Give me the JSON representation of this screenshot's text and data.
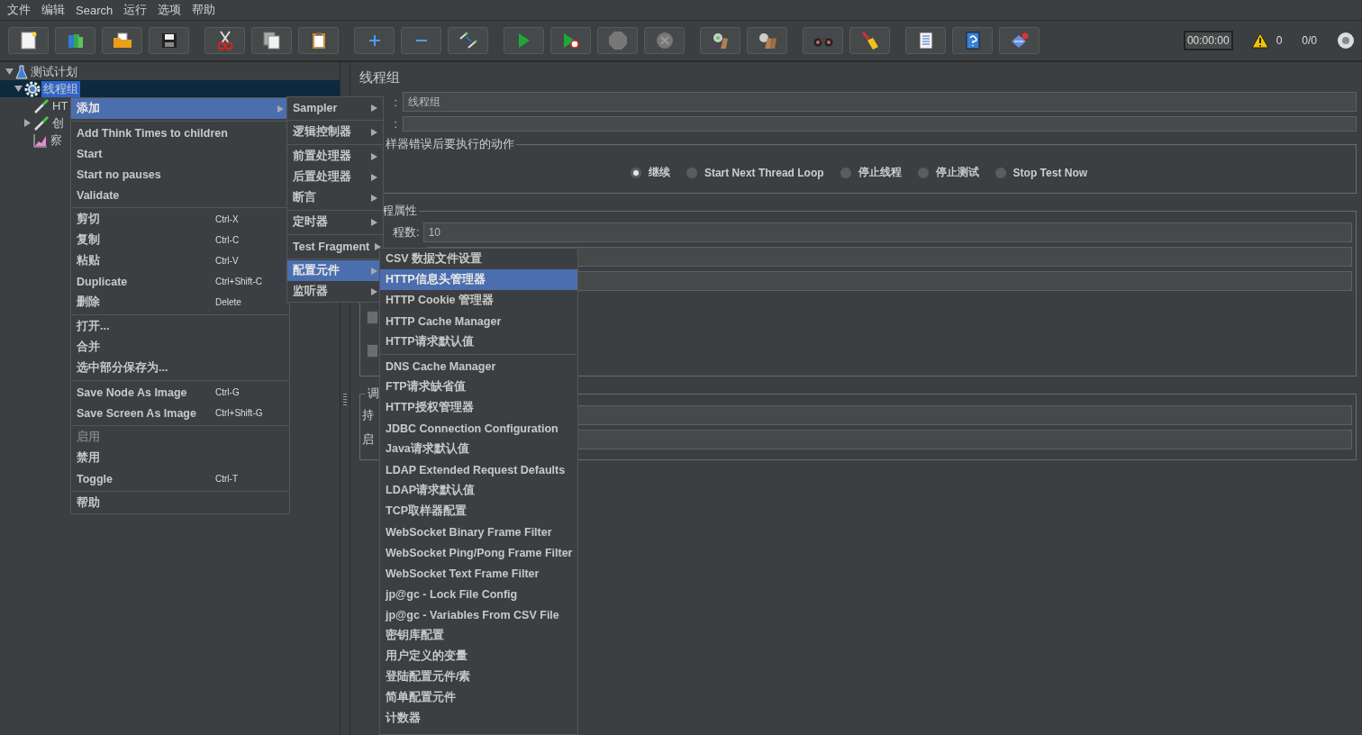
{
  "menubar": [
    {
      "label": "文件"
    },
    {
      "label": "编辑"
    },
    {
      "label": "Search"
    },
    {
      "label": "运行"
    },
    {
      "label": "选项"
    },
    {
      "label": "帮助"
    }
  ],
  "toolbar": {
    "timer": "00:00:00",
    "warnings": "0",
    "threads": "0/0"
  },
  "tree": [
    {
      "label": "测试计划",
      "kind": "test_plan",
      "expanded": true,
      "selected": false,
      "children": [
        {
          "label": "线程组",
          "kind": "thread_group",
          "expanded": true,
          "selected": true,
          "children": [
            {
              "label": "HT",
              "kind": "sampler",
              "selected": false
            },
            {
              "label": "创",
              "kind": "sampler",
              "expanded": false,
              "selected": false
            },
            {
              "label": "察",
              "kind": "listener",
              "selected": false
            }
          ]
        }
      ]
    }
  ],
  "panel": {
    "title": "线程组",
    "name_field": {
      "label": ":",
      "value": "线程组"
    },
    "comment_field": {
      "label": ":"
    },
    "on_error": {
      "title": "样器错误后要执行的动作",
      "options": [
        {
          "label": "继续",
          "selected": true
        },
        {
          "label": "Start Next Thread Loop",
          "selected": false
        },
        {
          "label": "停止线程",
          "selected": false
        },
        {
          "label": "停止测试",
          "selected": false
        },
        {
          "label": "Stop Test Now",
          "selected": false
        }
      ]
    },
    "thread_properties": {
      "title": "程属性",
      "threads_field": {
        "label": "程数:",
        "value": "10"
      },
      "checkboxes": [
        {
          "checked": false
        },
        {
          "checked": false
        }
      ]
    },
    "scheduler": {
      "title": "调",
      "fields": [
        {
          "label": "持"
        },
        {
          "label": "启"
        }
      ]
    }
  },
  "context_menu": {
    "sections": [
      [
        {
          "label": "添加",
          "submenu": true,
          "selected": true
        }
      ],
      [
        {
          "label": "Add Think Times to children"
        },
        {
          "label": "Start"
        },
        {
          "label": "Start no pauses"
        },
        {
          "label": "Validate"
        }
      ],
      [
        {
          "label": "剪切",
          "shortcut": "Ctrl-X"
        },
        {
          "label": "复制",
          "shortcut": "Ctrl-C"
        },
        {
          "label": "粘贴",
          "shortcut": "Ctrl-V"
        },
        {
          "label": "Duplicate",
          "shortcut": "Ctrl+Shift-C"
        },
        {
          "label": "删除",
          "shortcut": "Delete"
        }
      ],
      [
        {
          "label": "打开..."
        },
        {
          "label": "合并"
        },
        {
          "label": "选中部分保存为..."
        }
      ],
      [
        {
          "label": "Save Node As Image",
          "shortcut": "Ctrl-G"
        },
        {
          "label": "Save Screen As Image",
          "shortcut": "Ctrl+Shift-G"
        }
      ],
      [
        {
          "label": "启用",
          "disabled": true
        },
        {
          "label": "禁用"
        },
        {
          "label": "Toggle",
          "shortcut": "Ctrl-T"
        }
      ],
      [
        {
          "label": "帮助"
        }
      ]
    ]
  },
  "add_submenu": {
    "sections": [
      [
        {
          "label": "Sampler",
          "submenu": true,
          "selected": false
        }
      ],
      [
        {
          "label": "逻辑控制器",
          "submenu": true,
          "selected": false
        }
      ],
      [
        {
          "label": "前置处理器",
          "submenu": true,
          "selected": false
        },
        {
          "label": "后置处理器",
          "submenu": true,
          "selected": false
        },
        {
          "label": "断言",
          "submenu": true,
          "selected": false
        }
      ],
      [
        {
          "label": "定时器",
          "submenu": true,
          "selected": false
        }
      ],
      [
        {
          "label": "Test Fragment",
          "submenu": true,
          "selected": false
        }
      ],
      [
        {
          "label": "配置元件",
          "submenu": true,
          "selected": true
        },
        {
          "label": "监听器",
          "submenu": true,
          "selected": false
        }
      ]
    ]
  },
  "config_submenu": {
    "sections": [
      [
        {
          "label": "CSV 数据文件设置",
          "selected": false
        },
        {
          "label": "HTTP信息头管理器",
          "selected": true
        },
        {
          "label": "HTTP Cookie 管理器",
          "selected": false
        },
        {
          "label": "HTTP Cache Manager",
          "selected": false
        },
        {
          "label": "HTTP请求默认值",
          "selected": false
        }
      ],
      [
        {
          "label": "DNS Cache Manager",
          "selected": false
        },
        {
          "label": "FTP请求缺省值",
          "selected": false
        },
        {
          "label": "HTTP授权管理器",
          "selected": false
        },
        {
          "label": "JDBC Connection Configuration",
          "selected": false
        },
        {
          "label": "Java请求默认值",
          "selected": false
        },
        {
          "label": "LDAP Extended Request Defaults",
          "selected": false
        },
        {
          "label": "LDAP请求默认值",
          "selected": false
        },
        {
          "label": "TCP取样器配置",
          "selected": false
        },
        {
          "label": "WebSocket Binary Frame Filter",
          "selected": false
        },
        {
          "label": "WebSocket Ping/Pong Frame Filter",
          "selected": false
        },
        {
          "label": "WebSocket Text Frame Filter",
          "selected": false
        },
        {
          "label": "jp@gc - Lock File Config",
          "selected": false
        },
        {
          "label": "jp@gc - Variables From CSV File",
          "selected": false
        },
        {
          "label": "密钥库配置",
          "selected": false
        },
        {
          "label": "用户定义的变量",
          "selected": false
        },
        {
          "label": "登陆配置元件/素",
          "selected": false
        },
        {
          "label": "简单配置元件",
          "selected": false
        },
        {
          "label": "计数器",
          "selected": false
        }
      ]
    ]
  }
}
